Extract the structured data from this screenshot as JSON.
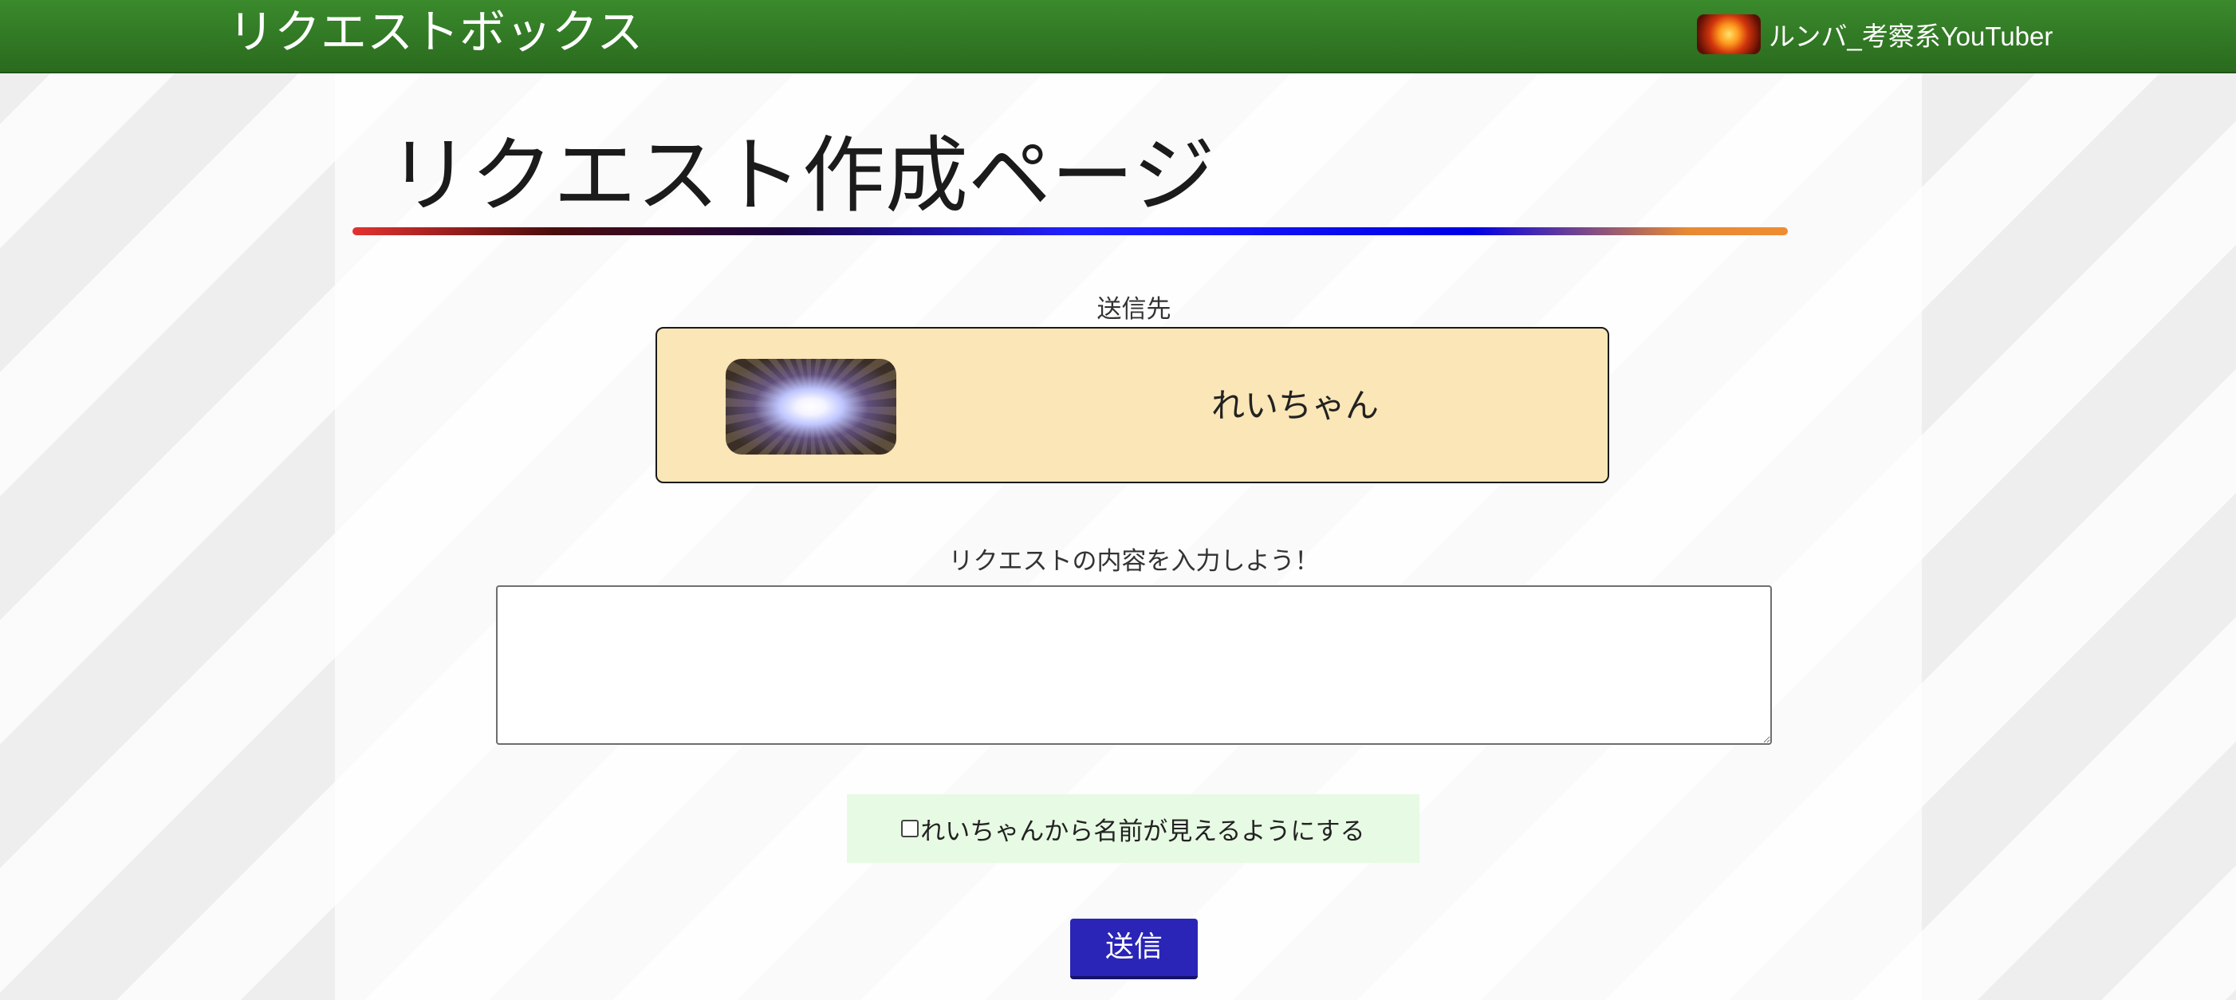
{
  "header": {
    "site_title": "リクエストボックス",
    "user_name": "ルンバ_考察系YouTuber",
    "colors": {
      "bar": "#2f7a24",
      "text": "#ffffff"
    }
  },
  "page": {
    "title": "リクエスト作成ページ"
  },
  "recipient": {
    "label": "送信先",
    "name": "れいちゃん",
    "card_color": "#fae6b6"
  },
  "request": {
    "label": "リクエストの内容を入力しよう！",
    "value": "",
    "placeholder": ""
  },
  "anonymity": {
    "checked": false,
    "label": "れいちゃんから名前が見えるようにする"
  },
  "submit": {
    "label": "送信",
    "color": "#2a25b6"
  }
}
